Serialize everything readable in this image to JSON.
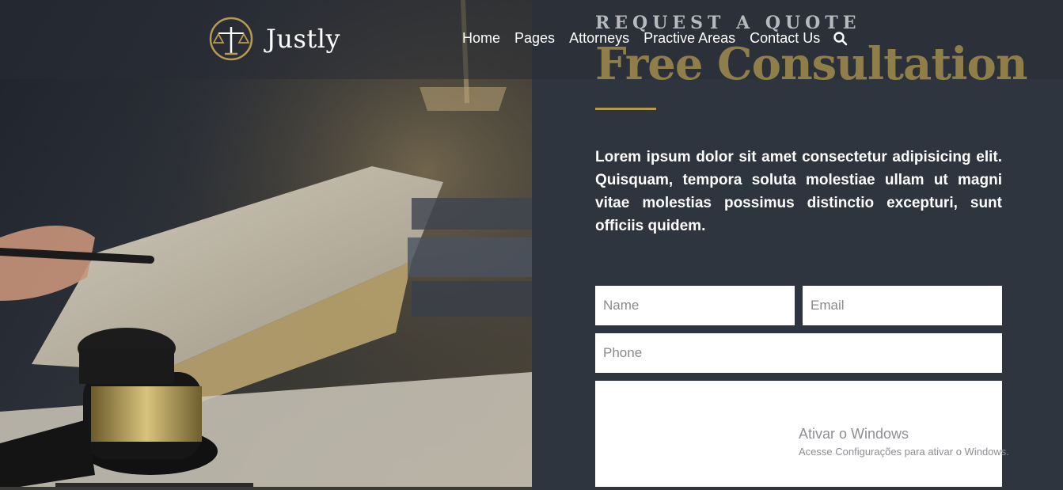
{
  "brand": {
    "name": "Justly",
    "logo_icon": "scales-of-justice-icon",
    "accent": "#b79b51"
  },
  "nav": {
    "items": [
      "Home",
      "Pages",
      "Attorneys",
      "Practive Areas",
      "Contact Us"
    ],
    "search_icon": "search-icon"
  },
  "hero": {
    "kicker": "REQUEST A QUOTE",
    "title": "Free Consultation",
    "description": "Lorem ipsum dolor sit amet consectetur adipisicing elit. Quisquam, tempora soluta molestiae ullam ut magni vitae molestias possimus distinctio excepturi, sunt officiis quidem."
  },
  "form": {
    "name_placeholder": "Name",
    "email_placeholder": "Email",
    "phone_placeholder": "Phone",
    "message_placeholder": ""
  },
  "watermark": {
    "title": "Ativar o Windows",
    "subtitle": "Acesse Configurações para ativar o Windows."
  },
  "colors": {
    "panel": "#2f353e",
    "title_gold": "#8f7e49",
    "text": "#ffffff"
  }
}
